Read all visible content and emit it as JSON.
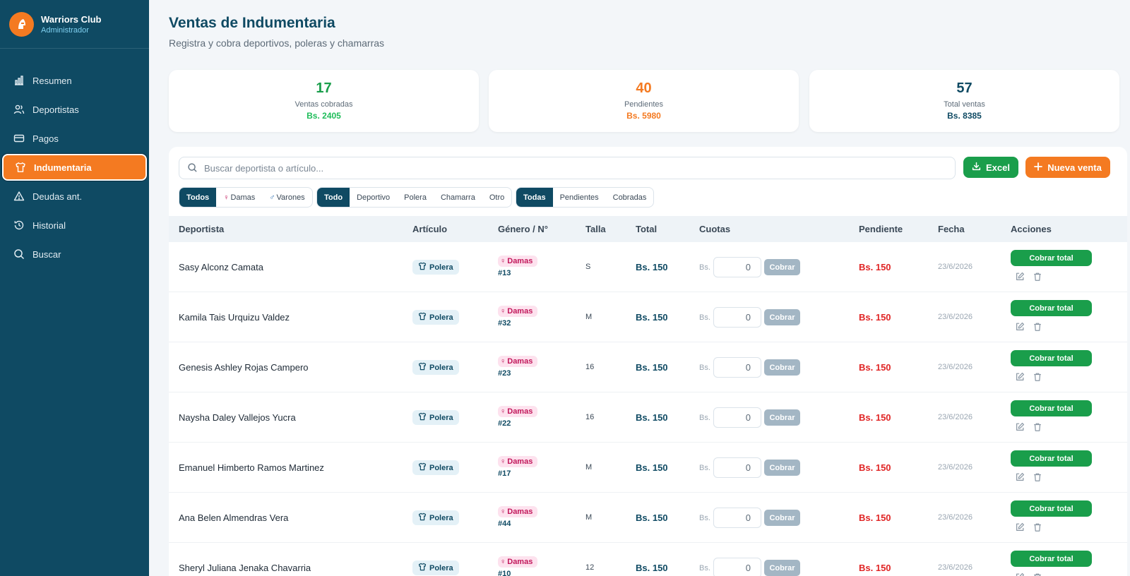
{
  "brand": {
    "title": "Warriors Club",
    "role": "Administrador",
    "logo_icon": "spartan-helmet-icon"
  },
  "nav": [
    {
      "label": "Resumen",
      "icon": "bar-chart-icon"
    },
    {
      "label": "Deportistas",
      "icon": "users-icon"
    },
    {
      "label": "Pagos",
      "icon": "credit-card-icon"
    },
    {
      "label": "Indumentaria",
      "icon": "shirt-icon",
      "active": true
    },
    {
      "label": "Deudas ant.",
      "icon": "warning-icon"
    },
    {
      "label": "Historial",
      "icon": "history-icon"
    },
    {
      "label": "Buscar",
      "icon": "search-icon"
    }
  ],
  "page": {
    "title": "Ventas de Indumentaria",
    "subtitle": "Registra y cobra deportivos, poleras y chamarras"
  },
  "stats": [
    {
      "value": "17",
      "label": "Ventas cobradas",
      "amount": "Bs. 2405",
      "color": "#1a9e4b"
    },
    {
      "value": "40",
      "label": "Pendientes",
      "amount": "Bs. 5980",
      "color": "#f47a21"
    },
    {
      "value": "57",
      "label": "Total ventas",
      "amount": "Bs. 8385",
      "color": "#0f4a63"
    }
  ],
  "search": {
    "placeholder": "Buscar deportista o artículo..."
  },
  "actions": {
    "excel": "Excel",
    "new_sale": "Nueva venta"
  },
  "filters": {
    "gender": [
      "Todos",
      "Damas",
      "Varones"
    ],
    "article": [
      "Todo",
      "Deportivo",
      "Polera",
      "Chamarra",
      "Otro"
    ],
    "status": [
      "Todas",
      "Pendientes",
      "Cobradas"
    ]
  },
  "table": {
    "headers": [
      "Deportista",
      "Artículo",
      "Género / N°",
      "Talla",
      "Total",
      "Cuotas",
      "Pendiente",
      "Fecha",
      "Acciones"
    ],
    "currency_prefix": "Bs.",
    "pay_button": "Cobrar",
    "pay_total_button": "Cobrar total",
    "rows": [
      {
        "name": "Sasy Alconz Camata",
        "article": "Polera",
        "gender": "Damas",
        "number": "#13",
        "size": "S",
        "total": "Bs. 150",
        "installment": "0",
        "pending": "Bs. 150",
        "date": "23/6/2026"
      },
      {
        "name": "Kamila Tais Urquizu Valdez",
        "article": "Polera",
        "gender": "Damas",
        "number": "#32",
        "size": "M",
        "total": "Bs. 150",
        "installment": "0",
        "pending": "Bs. 150",
        "date": "23/6/2026"
      },
      {
        "name": "Genesis Ashley Rojas Campero",
        "article": "Polera",
        "gender": "Damas",
        "number": "#23",
        "size": "16",
        "total": "Bs. 150",
        "installment": "0",
        "pending": "Bs. 150",
        "date": "23/6/2026"
      },
      {
        "name": "Naysha Daley Vallejos Yucra",
        "article": "Polera",
        "gender": "Damas",
        "number": "#22",
        "size": "16",
        "total": "Bs. 150",
        "installment": "0",
        "pending": "Bs. 150",
        "date": "23/6/2026"
      },
      {
        "name": "Emanuel Himberto Ramos Martinez",
        "article": "Polera",
        "gender": "Damas",
        "number": "#17",
        "size": "M",
        "total": "Bs. 150",
        "installment": "0",
        "pending": "Bs. 150",
        "date": "23/6/2026"
      },
      {
        "name": "Ana Belen Almendras Vera",
        "article": "Polera",
        "gender": "Damas",
        "number": "#44",
        "size": "M",
        "total": "Bs. 150",
        "installment": "0",
        "pending": "Bs. 150",
        "date": "23/6/2026"
      },
      {
        "name": "Sheryl Juliana Jenaka Chavarria",
        "article": "Polera",
        "gender": "Damas",
        "number": "#10",
        "size": "12",
        "total": "Bs. 150",
        "installment": "0",
        "pending": "Bs. 150",
        "date": "23/6/2026"
      }
    ]
  }
}
